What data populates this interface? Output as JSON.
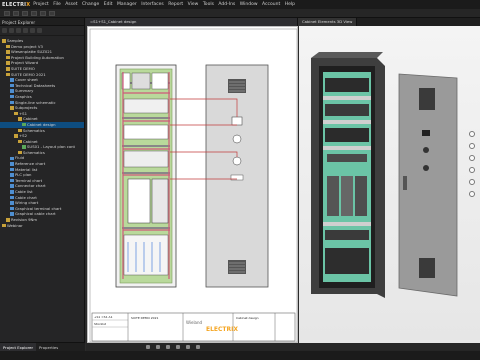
{
  "app": {
    "logo_prefix": "ELECTRI",
    "logo_suffix": "X"
  },
  "menu": [
    "Project",
    "File",
    "Asset",
    "Change",
    "Edit",
    "Manager",
    "Interfaces",
    "Report",
    "View",
    "Tools",
    "Add-Ins",
    "Window",
    "Account",
    "Help"
  ],
  "left_panel": {
    "title": "Project Explorer",
    "tree": [
      {
        "label": "Samples",
        "indent": 0,
        "kind": "folder"
      },
      {
        "label": "Demo project V3",
        "indent": 1,
        "kind": "folder"
      },
      {
        "label": "Wiesenplatte SUZ021",
        "indent": 1,
        "kind": "folder"
      },
      {
        "label": "Project Building Automation",
        "indent": 1,
        "kind": "folder"
      },
      {
        "label": "Project Wizard",
        "indent": 1,
        "kind": "folder"
      },
      {
        "label": "SUITE DEMO",
        "indent": 1,
        "kind": "folder"
      },
      {
        "label": "SUITE DEMO 2021",
        "indent": 1,
        "kind": "folder"
      },
      {
        "label": "Cover sheet",
        "indent": 2,
        "kind": "blue"
      },
      {
        "label": "Technical Datasheets",
        "indent": 2,
        "kind": "blue"
      },
      {
        "label": "Summary",
        "indent": 2,
        "kind": "blue"
      },
      {
        "label": "Graphics",
        "indent": 2,
        "kind": "blue"
      },
      {
        "label": "Single-line schematic",
        "indent": 2,
        "kind": "blue"
      },
      {
        "label": "Subprojects",
        "indent": 2,
        "kind": "folder"
      },
      {
        "label": "+S1",
        "indent": 3,
        "kind": "folder"
      },
      {
        "label": "Cabinet",
        "indent": 4,
        "kind": "folder"
      },
      {
        "label": "Cabinet design",
        "indent": 5,
        "kind": "green",
        "selected": true
      },
      {
        "label": "Schematics",
        "indent": 4,
        "kind": "folder"
      },
      {
        "label": "+S2",
        "indent": 3,
        "kind": "folder"
      },
      {
        "label": "Cabinet",
        "indent": 4,
        "kind": "folder"
      },
      {
        "label": "SUS01 - Layout plan cont",
        "indent": 5,
        "kind": "green"
      },
      {
        "label": "Schematics",
        "indent": 4,
        "kind": "folder"
      },
      {
        "label": "Fluid",
        "indent": 2,
        "kind": "blue"
      },
      {
        "label": "Reference chart",
        "indent": 2,
        "kind": "blue"
      },
      {
        "label": "Material list",
        "indent": 2,
        "kind": "blue"
      },
      {
        "label": "PLC plan",
        "indent": 2,
        "kind": "blue"
      },
      {
        "label": "Terminal chart",
        "indent": 2,
        "kind": "blue"
      },
      {
        "label": "Connector chart",
        "indent": 2,
        "kind": "blue"
      },
      {
        "label": "Cable list",
        "indent": 2,
        "kind": "blue"
      },
      {
        "label": "Cable chart",
        "indent": 2,
        "kind": "blue"
      },
      {
        "label": "Wiring chart",
        "indent": 2,
        "kind": "blue"
      },
      {
        "label": "Graphical terminal chart",
        "indent": 2,
        "kind": "blue"
      },
      {
        "label": "Graphical cable chart",
        "indent": 2,
        "kind": "blue"
      },
      {
        "label": "Revision 9Nm",
        "indent": 1,
        "kind": "folder"
      },
      {
        "label": "Webinar",
        "indent": 0,
        "kind": "folder"
      }
    ]
  },
  "bottom_tabs": [
    "Project Explorer",
    "Properties"
  ],
  "doc_tabs": [
    "=S1+S1_Cabinet design",
    "Cabinet Elements 3D View"
  ],
  "title_block": {
    "row1": "+S1 =S1 A1",
    "row2": "Stücklst",
    "project": "SUITE DEMO 2021",
    "brand": "Wieland",
    "brand_sub": "ELECTRIX",
    "drawing": "Cabinet design"
  },
  "colors": {
    "accent": "#f5a623",
    "selection": "#0e4d80",
    "wire": "#c23b3b",
    "rail": "#3dbd8f"
  }
}
